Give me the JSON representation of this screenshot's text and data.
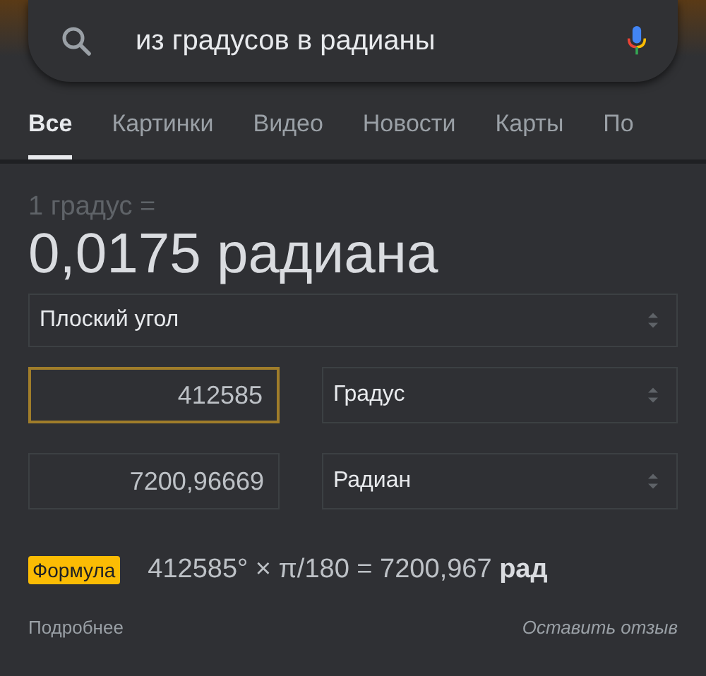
{
  "search": {
    "value": "из градусов в радианы"
  },
  "tabs": [
    {
      "label": "Все",
      "selected": true
    },
    {
      "label": "Картинки",
      "selected": false
    },
    {
      "label": "Видео",
      "selected": false
    },
    {
      "label": "Новости",
      "selected": false
    },
    {
      "label": "Карты",
      "selected": false
    },
    {
      "label": "По",
      "selected": false
    }
  ],
  "converter": {
    "caption": "1 градус =",
    "result": "0,0175 радиана",
    "category": "Плоский угол",
    "rows": [
      {
        "value": "412585",
        "unit": "Градус",
        "focused": true
      },
      {
        "value": "7200,96669",
        "unit": "Радиан",
        "focused": false
      }
    ],
    "formula_badge": "Формула",
    "formula": "412585° × π/180 = 7200,967 **рад**",
    "more_link": "Подробнее",
    "feedback_link": "Оставить отзыв"
  }
}
